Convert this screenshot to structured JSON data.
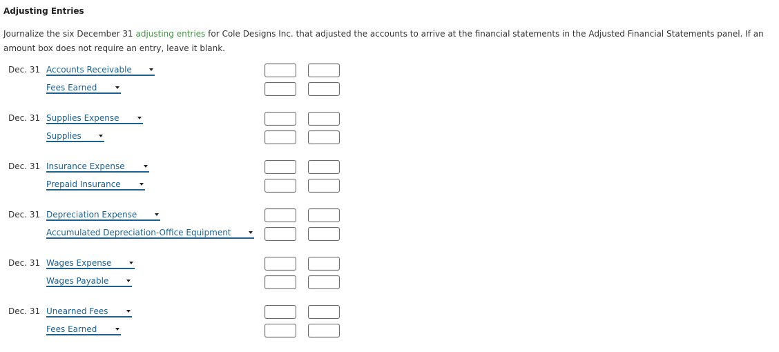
{
  "title": "Adjusting Entries",
  "instructions": {
    "before_link": "Journalize the six December 31 ",
    "link": "adjusting entries",
    "after_link": " for Cole Designs Inc. that adjusted the accounts to arrive at the financial statements in the Adjusted Financial Statements panel. If an amount box does not require an entry, leave it blank."
  },
  "colors": {
    "link": "#4a8f4a",
    "account": "#1f5f8b"
  },
  "entries": [
    {
      "date": "Dec. 31",
      "debit_account": "Accounts Receivable",
      "credit_account": "Fees Earned",
      "debit_amounts": [
        "",
        ""
      ],
      "credit_amounts": [
        "",
        ""
      ]
    },
    {
      "date": "Dec. 31",
      "debit_account": "Supplies Expense",
      "credit_account": "Supplies",
      "debit_amounts": [
        "",
        ""
      ],
      "credit_amounts": [
        "",
        ""
      ]
    },
    {
      "date": "Dec. 31",
      "debit_account": "Insurance Expense",
      "credit_account": "Prepaid Insurance",
      "debit_amounts": [
        "",
        ""
      ],
      "credit_amounts": [
        "",
        ""
      ]
    },
    {
      "date": "Dec. 31",
      "debit_account": "Depreciation Expense",
      "credit_account": "Accumulated Depreciation-Office Equipment",
      "debit_amounts": [
        "",
        ""
      ],
      "credit_amounts": [
        "",
        ""
      ]
    },
    {
      "date": "Dec. 31",
      "debit_account": "Wages Expense",
      "credit_account": "Wages Payable",
      "debit_amounts": [
        "",
        ""
      ],
      "credit_amounts": [
        "",
        ""
      ]
    },
    {
      "date": "Dec. 31",
      "debit_account": "Unearned Fees",
      "credit_account": "Fees Earned",
      "debit_amounts": [
        "",
        ""
      ],
      "credit_amounts": [
        "",
        ""
      ]
    }
  ]
}
